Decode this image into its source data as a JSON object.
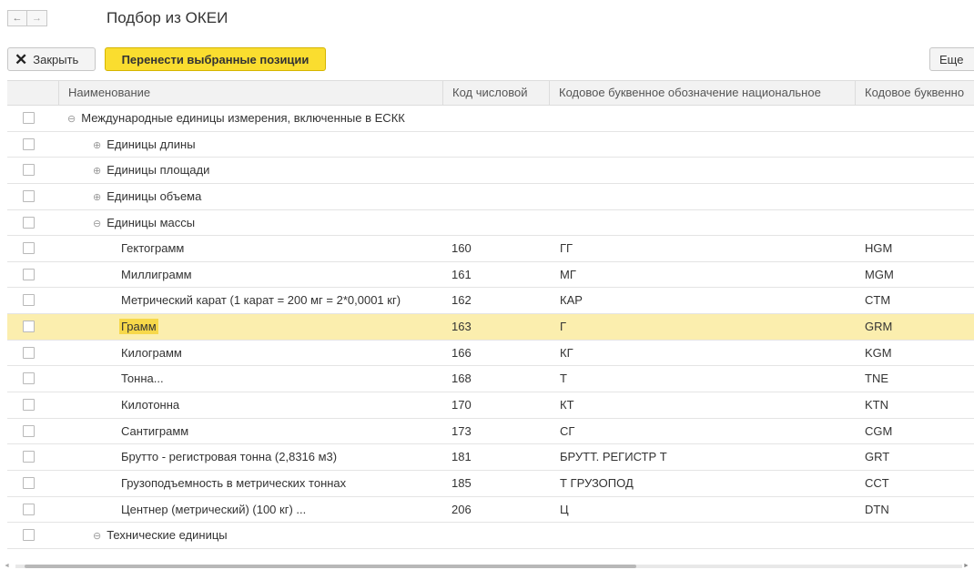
{
  "window": {
    "title": "Подбор из ОКЕИ"
  },
  "nav": {
    "back": "←",
    "forward": "→"
  },
  "toolbar": {
    "close_label": "Закрыть",
    "move_label": "Перенести выбранные позиции",
    "more_label": "Еще"
  },
  "columns": [
    "Наименование",
    "Код числовой",
    "Кодовое буквенное обозначение национальное",
    "Кодовое буквенно"
  ],
  "rows": [
    {
      "name": "Международные единицы измерения, включенные в ЕСКК",
      "level": 0,
      "toggle": "⊖",
      "code": "",
      "nat": "",
      "intl": "",
      "selected": false
    },
    {
      "name": "Единицы длины",
      "level": 1,
      "toggle": "⊕",
      "code": "",
      "nat": "",
      "intl": "",
      "selected": false
    },
    {
      "name": "Единицы площади",
      "level": 1,
      "toggle": "⊕",
      "code": "",
      "nat": "",
      "intl": "",
      "selected": false
    },
    {
      "name": "Единицы объема",
      "level": 1,
      "toggle": "⊕",
      "code": "",
      "nat": "",
      "intl": "",
      "selected": false
    },
    {
      "name": "Единицы массы",
      "level": 1,
      "toggle": "⊖",
      "code": "",
      "nat": "",
      "intl": "",
      "selected": false
    },
    {
      "name": "Гектограмм",
      "level": 2,
      "toggle": "",
      "code": "160",
      "nat": "ГГ",
      "intl": "HGM",
      "selected": false
    },
    {
      "name": "Миллиграмм",
      "level": 2,
      "toggle": "",
      "code": "161",
      "nat": "МГ",
      "intl": "MGM",
      "selected": false
    },
    {
      "name": "Метрический карат (1 карат = 200 мг = 2*0,0001 кг)",
      "level": 2,
      "toggle": "",
      "code": "162",
      "nat": "КАР",
      "intl": "CTM",
      "selected": false
    },
    {
      "name": "Грамм",
      "level": 2,
      "toggle": "",
      "code": "163",
      "nat": "Г",
      "intl": "GRM",
      "selected": true
    },
    {
      "name": "Килограмм",
      "level": 2,
      "toggle": "",
      "code": "166",
      "nat": "КГ",
      "intl": "KGM",
      "selected": false
    },
    {
      "name": "Тонна...",
      "level": 2,
      "toggle": "",
      "code": "168",
      "nat": "Т",
      "intl": "TNE",
      "selected": false
    },
    {
      "name": "Килотонна",
      "level": 2,
      "toggle": "",
      "code": "170",
      "nat": "КТ",
      "intl": "KTN",
      "selected": false
    },
    {
      "name": "Сантиграмм",
      "level": 2,
      "toggle": "",
      "code": "173",
      "nat": "СГ",
      "intl": "CGM",
      "selected": false
    },
    {
      "name": "Брутто - регистровая тонна (2,8316 м3)",
      "level": 2,
      "toggle": "",
      "code": "181",
      "nat": "БРУТТ. РЕГИСТР Т",
      "intl": "GRT",
      "selected": false
    },
    {
      "name": "Грузоподъемность в метрических тоннах",
      "level": 2,
      "toggle": "",
      "code": "185",
      "nat": "Т ГРУЗОПОД",
      "intl": "CCT",
      "selected": false
    },
    {
      "name": "Центнер (метрический) (100 кг) ...",
      "level": 2,
      "toggle": "",
      "code": "206",
      "nat": "Ц",
      "intl": "DTN",
      "selected": false
    },
    {
      "name": "Технические единицы",
      "level": 1,
      "toggle": "⊖",
      "code": "",
      "nat": "",
      "intl": "",
      "selected": false
    }
  ]
}
